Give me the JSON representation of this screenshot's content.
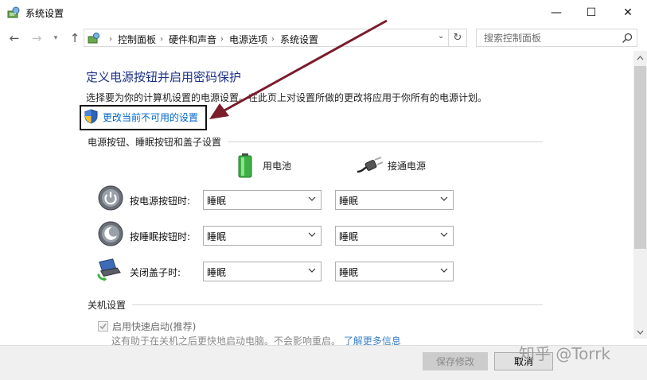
{
  "window": {
    "title": "系统设置",
    "minimize_glyph": "—",
    "maximize_glyph": "☐",
    "close_glyph": "✕"
  },
  "nav": {
    "back": "←",
    "forward": "→",
    "history_dropdown": "▾",
    "up": "↑",
    "breadcrumb": [
      "控制面板",
      "硬件和声音",
      "电源选项",
      "系统设置"
    ],
    "breadcrumb_separator": "›",
    "address_dropdown": "⌄",
    "refresh": "↻",
    "search_placeholder": "搜索控制面板"
  },
  "main": {
    "title": "定义电源按钮并启用密码保护",
    "description": "选择要为你的计算机设置的电源设置。在此页上对设置所做的更改将应用于你所有的电源计划。",
    "change_unavailable_link": "更改当前不可用的设置",
    "power_group_header": "电源按钮、睡眠按钮和盖子设置",
    "columns": {
      "battery": "用电池",
      "plugged_in": "接通电源"
    },
    "rows": [
      {
        "label": "按电源按钮时:",
        "icon": "power-button-icon",
        "battery": "睡眠",
        "plugged_in": "睡眠"
      },
      {
        "label": "按睡眠按钮时:",
        "icon": "sleep-button-icon",
        "battery": "睡眠",
        "plugged_in": "睡眠"
      },
      {
        "label": "关闭盖子时:",
        "icon": "laptop-lid-icon",
        "battery": "睡眠",
        "plugged_in": "睡眠"
      }
    ],
    "shutdown_group_header": "关机设置",
    "fast_startup": {
      "label": "启用快速启动(推荐)",
      "checked": true,
      "disabled": true
    },
    "fast_startup_desc": "这有助于在关机之后更快地启动电脑。不会影响重启。",
    "fast_startup_link": "了解更多信息"
  },
  "footer": {
    "save": "保存修改",
    "cancel": "取消"
  },
  "watermark": "知乎 @Torrk",
  "colors": {
    "title_blue": "#1e3287",
    "link_blue": "#0066cc",
    "annotation_arrow": "#7a1c2a"
  }
}
